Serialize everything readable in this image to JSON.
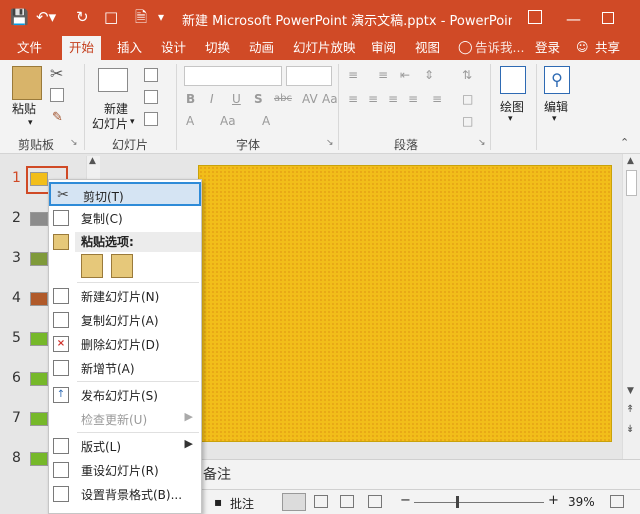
{
  "titlebar": {
    "title": "新建 Microsoft PowerPoint 演示文稿.pptx - PowerPoint(..."
  },
  "tabs": {
    "file": "文件",
    "home": "开始",
    "insert": "插入",
    "design": "设计",
    "transitions": "切换",
    "animations": "动画",
    "slideshow": "幻灯片放映",
    "review": "审阅",
    "view": "视图",
    "tellme": "告诉我...",
    "login": "登录",
    "share": "共享"
  },
  "ribbon": {
    "paste": "粘贴",
    "new_slide_line1": "新建",
    "new_slide_line2": "幻灯片",
    "drawing": "绘图",
    "editing": "编辑",
    "groups": {
      "clipboard": "剪贴板",
      "slides": "幻灯片",
      "font": "字体",
      "paragraph": "段落"
    }
  },
  "slides": {
    "numbers": [
      "1",
      "2",
      "3",
      "4",
      "5",
      "6",
      "7",
      "8"
    ],
    "thumb_colors": [
      "#f2be1a",
      "#8c8c8c",
      "#7f9a3a",
      "#b05a2a",
      "#76b82a",
      "#76b82a",
      "#76b82a",
      "#76b82a"
    ]
  },
  "context_menu": {
    "cut": "剪切(T)",
    "copy": "复制(C)",
    "paste_options": "粘贴选项:",
    "new_slide": "新建幻灯片(N)",
    "duplicate_slide": "复制幻灯片(A)",
    "delete_slide": "删除幻灯片(D)",
    "add_section": "新增节(A)",
    "publish_slides": "发布幻灯片(S)",
    "check_updates": "检查更新(U)",
    "layout": "版式(L)",
    "reset_slide": "重设幻灯片(R)",
    "format_background": "设置背景格式(B)..."
  },
  "notes": {
    "label": "备注"
  },
  "statusbar": {
    "comments": "批注",
    "zoom": "39%"
  },
  "colors": {
    "accent": "#d04a26",
    "slide_fill": "#f2be1a",
    "menu_highlight": "#2e8bd8"
  }
}
